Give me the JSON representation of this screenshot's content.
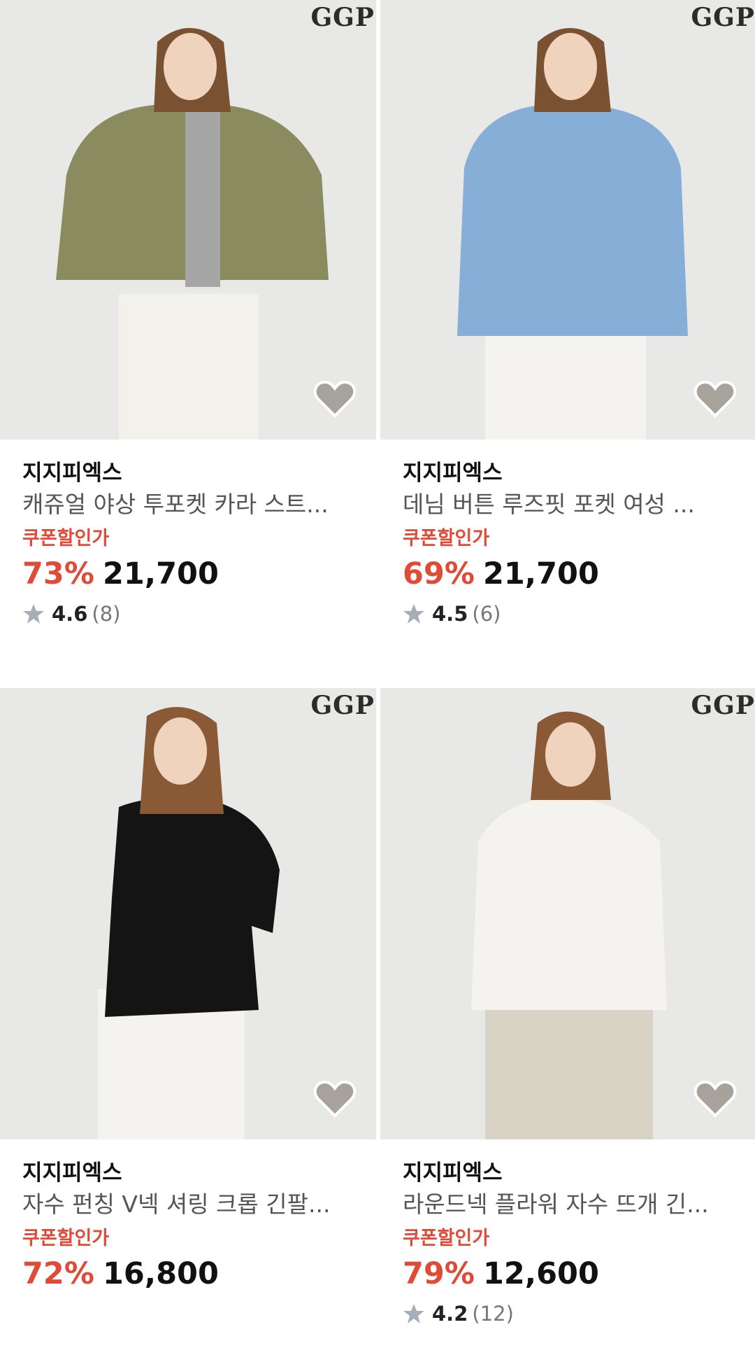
{
  "products": [
    {
      "logo": "GGP",
      "brand": "지지피엑스",
      "title": "캐쥬얼 야상 투포켓 카라 스트...",
      "coupon_label": "쿠폰할인가",
      "discount": "73%",
      "price": "21,700",
      "rating": "4.6",
      "review_count": "(8)",
      "garment_color": "#8a8b5e"
    },
    {
      "logo": "GGP",
      "brand": "지지피엑스",
      "title": "데님 버튼 루즈핏 포켓 여성 ...",
      "coupon_label": "쿠폰할인가",
      "discount": "69%",
      "price": "21,700",
      "rating": "4.5",
      "review_count": "(6)",
      "garment_color": "#86aed6"
    },
    {
      "logo": "GGP",
      "brand": "지지피엑스",
      "title": "자수 펀칭 V넥 셔링 크롭 긴팔...",
      "coupon_label": "쿠폰할인가",
      "discount": "72%",
      "price": "16,800",
      "garment_color": "#141414"
    },
    {
      "logo": "GGP",
      "brand": "지지피엑스",
      "title": "라운드넥 플라워 자수 뜨개 긴...",
      "coupon_label": "쿠폰할인가",
      "discount": "79%",
      "price": "12,600",
      "rating": "4.2",
      "review_count": "(12)",
      "garment_color": "#f4f3ef"
    }
  ],
  "colors": {
    "accent": "#e04b38",
    "heart": "#a8a29c",
    "star": "#a7aeb8"
  }
}
